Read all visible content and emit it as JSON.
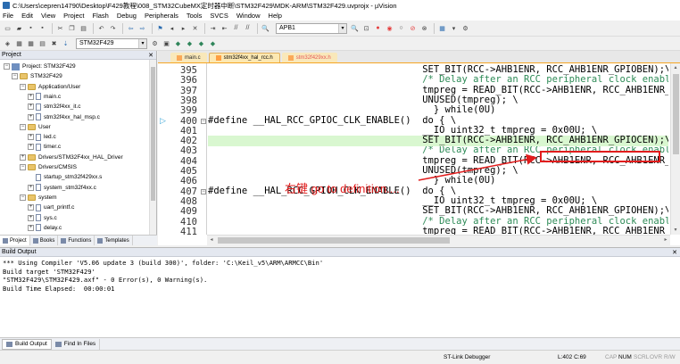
{
  "window": {
    "title": "C:\\Users\\cepren14790\\Desktop\\F429教程\\008_STM32CubeMX定时器中断\\STM32F429\\MDK-ARM\\STM32F429.uvprojx - µVision"
  },
  "menu": [
    "File",
    "Edit",
    "View",
    "Project",
    "Flash",
    "Debug",
    "Peripherals",
    "Tools",
    "SVCS",
    "Window",
    "Help"
  ],
  "toolbar": {
    "find_combo": "APB1",
    "target_combo": "STM32F429"
  },
  "project_panel": {
    "title": "Project",
    "tree": [
      {
        "label": "Project: STM32F429",
        "level": 0,
        "kind": "root",
        "exp": "−"
      },
      {
        "label": "STM32F429",
        "level": 1,
        "kind": "folder",
        "exp": "−"
      },
      {
        "label": "Application/User",
        "level": 2,
        "kind": "folder",
        "exp": "−"
      },
      {
        "label": "main.c",
        "level": 3,
        "kind": "file",
        "exp": "+"
      },
      {
        "label": "stm32f4xx_it.c",
        "level": 3,
        "kind": "file",
        "exp": "+"
      },
      {
        "label": "stm32f4xx_hal_msp.c",
        "level": 3,
        "kind": "file",
        "exp": "+"
      },
      {
        "label": "User",
        "level": 2,
        "kind": "folder",
        "exp": "−"
      },
      {
        "label": "led.c",
        "level": 3,
        "kind": "file",
        "exp": "+"
      },
      {
        "label": "timer.c",
        "level": 3,
        "kind": "file",
        "exp": "+"
      },
      {
        "label": "Drivers/STM32F4xx_HAL_Driver",
        "level": 2,
        "kind": "folder",
        "exp": "+"
      },
      {
        "label": "Drivers/CMSIS",
        "level": 2,
        "kind": "folder",
        "exp": "−"
      },
      {
        "label": "startup_stm32f429xx.s",
        "level": 3,
        "kind": "file",
        "exp": ""
      },
      {
        "label": "system_stm32f4xx.c",
        "level": 3,
        "kind": "file",
        "exp": "+"
      },
      {
        "label": "system",
        "level": 2,
        "kind": "folder",
        "exp": "−"
      },
      {
        "label": "uart_printf.c",
        "level": 3,
        "kind": "file",
        "exp": "+"
      },
      {
        "label": "sys.c",
        "level": 3,
        "kind": "file",
        "exp": "+"
      },
      {
        "label": "delay.c",
        "level": 3,
        "kind": "file",
        "exp": "+"
      }
    ],
    "tabs": [
      "Project",
      "Books",
      "Functions",
      "Templates"
    ]
  },
  "editor": {
    "tabs": [
      {
        "label": "main.c",
        "state": "inactive"
      },
      {
        "label": "stm32f4xx_hal_rcc.h",
        "state": "active"
      },
      {
        "label": "stm32f429xx.h",
        "state": "red"
      }
    ],
    "lines": [
      {
        "n": "395",
        "text": "                                      SET_BIT(RCC->AHB1ENR, RCC_AHB1ENR_GPIOBEN);\\"
      },
      {
        "n": "396",
        "text": "                                      /* Delay after an RCC peripheral clock enabl",
        "cls": "cmt"
      },
      {
        "n": "397",
        "text": "                                      tmpreg = READ_BIT(RCC->AHB1ENR, RCC_AHB1ENR_"
      },
      {
        "n": "398",
        "text": "                                      UNUSED(tmpreg); \\"
      },
      {
        "n": "399",
        "text": "                                        } while(0U)"
      },
      {
        "n": "400",
        "text": "#define __HAL_RCC_GPIOC_CLK_ENABLE()  do { \\",
        "marker": true,
        "fold": true
      },
      {
        "n": "401",
        "text": "                                      __IO uint32_t tmpreg = 0x00U; \\"
      },
      {
        "n": "402",
        "text": "                                      SET_BIT(RCC->AHB1ENR, RCC_AHB1ENR_GPIOCEN);\\",
        "hl": true
      },
      {
        "n": "403",
        "text": "                                      /* Delay after an RCC peripheral clock enabl",
        "cls": "cmt"
      },
      {
        "n": "404",
        "text": "                                      tmpreg = READ_BIT(RCC->AHB1ENR, RCC_AHB1ENR_"
      },
      {
        "n": "405",
        "text": "                                      UNUSED(tmpreg); \\"
      },
      {
        "n": "406",
        "text": "                                        } while(0U)"
      },
      {
        "n": "407",
        "text": "#define __HAL_RCC_GPIOH_CLK_ENABLE()  do { \\",
        "fold": true
      },
      {
        "n": "408",
        "text": "                                      __IO uint32_t tmpreg = 0x00U; \\"
      },
      {
        "n": "409",
        "text": "                                      SET_BIT(RCC->AHB1ENR, RCC_AHB1ENR_GPIOHEN);\\"
      },
      {
        "n": "410",
        "text": "                                      /* Delay after an RCC peripheral clock enabl",
        "cls": "cmt"
      },
      {
        "n": "411",
        "text": "                                      tmpreg = READ_BIT(RCC->AHB1ENR, RCC_AHB1ENR_"
      }
    ],
    "annotation": "右键 go to definition...."
  },
  "build_output": {
    "title": "Build Output",
    "lines": [
      "*** Using Compiler 'V5.06 update 3 (build 300)', folder: 'C:\\Keil_v5\\ARM\\ARMCC\\Bin'",
      "Build target 'STM32F429'",
      "\"STM32F429\\STM32F429.axf\" - 0 Error(s), 0 Warning(s).",
      "Build Time Elapsed:  00:00:01"
    ],
    "tabs": [
      "Build Output",
      "Find In Files"
    ]
  },
  "status": {
    "debugger": "ST-Link Debugger",
    "position": "L:402 C:69",
    "caps": "CAP",
    "num": "NUM",
    "scrl": "SCRL",
    "ovr": "OVR",
    "rw": "R/W"
  }
}
